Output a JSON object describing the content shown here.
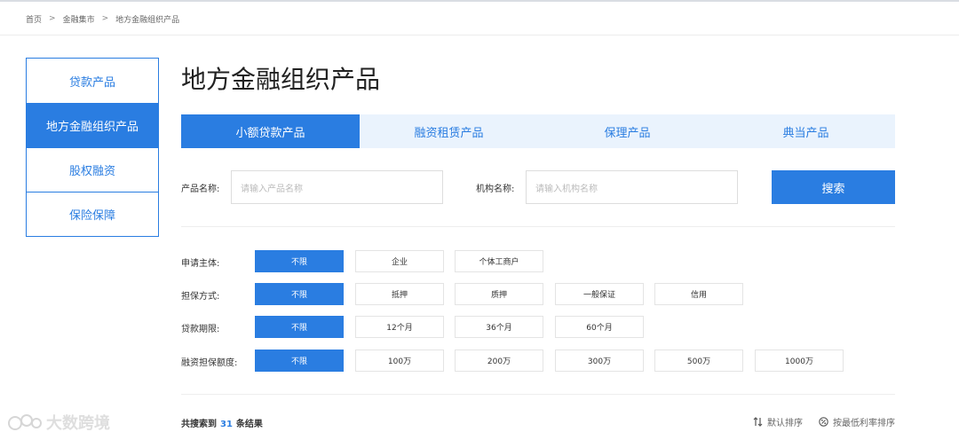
{
  "breadcrumb": {
    "items": [
      "首页",
      "金融集市",
      "地方金融组织产品"
    ],
    "separator": ">"
  },
  "sidebar": {
    "items": [
      {
        "label": "贷款产品",
        "active": false
      },
      {
        "label": "地方金融组织产品",
        "active": true
      },
      {
        "label": "股权融资",
        "active": false
      },
      {
        "label": "保险保障",
        "active": false
      }
    ]
  },
  "page": {
    "title": "地方金融组织产品"
  },
  "tabs": [
    {
      "label": "小额贷款产品",
      "active": true
    },
    {
      "label": "融资租赁产品",
      "active": false
    },
    {
      "label": "保理产品",
      "active": false
    },
    {
      "label": "典当产品",
      "active": false
    }
  ],
  "search": {
    "product_label": "产品名称:",
    "product_placeholder": "请输入产品名称",
    "org_label": "机构名称:",
    "org_placeholder": "请输入机构名称",
    "button_label": "搜索"
  },
  "filters": [
    {
      "label": "申请主体:",
      "options": [
        "不限",
        "企业",
        "个体工商户"
      ],
      "selected": 0
    },
    {
      "label": "担保方式:",
      "options": [
        "不限",
        "抵押",
        "质押",
        "一般保证",
        "信用"
      ],
      "selected": 0
    },
    {
      "label": "贷款期限:",
      "options": [
        "不限",
        "12个月",
        "36个月",
        "60个月"
      ],
      "selected": 0
    },
    {
      "label": "融资担保额度:",
      "options": [
        "不限",
        "100万",
        "200万",
        "300万",
        "500万",
        "1000万"
      ],
      "selected": 0
    }
  ],
  "results": {
    "prefix": "共搜索到",
    "count": "31",
    "suffix": "条结果"
  },
  "sort": {
    "default_label": "默认排序",
    "rate_label": "按最低利率排序",
    "default_icon": "sort-arrows-icon",
    "rate_icon": "percent-circle-icon"
  },
  "watermark": {
    "text": "大数跨境"
  },
  "colors": {
    "primary": "#2a7de1",
    "tab_bg": "#eaf3fd",
    "border": "#e4e4e4"
  }
}
